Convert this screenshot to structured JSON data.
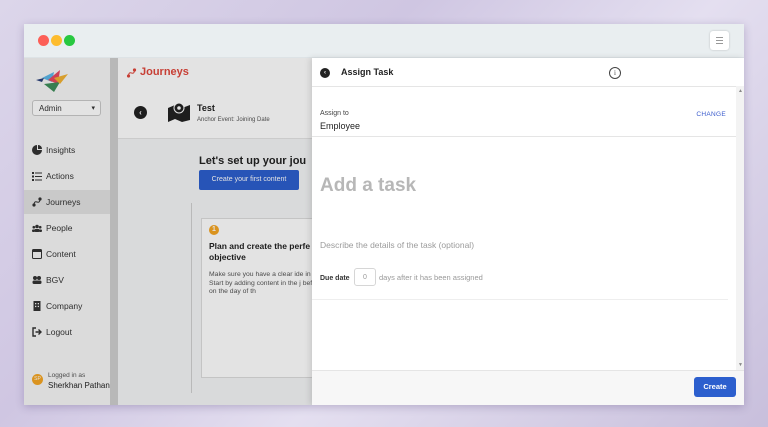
{
  "sidebar": {
    "role_select": "Admin",
    "items": [
      {
        "label": "Insights",
        "icon": "pie-chart-icon"
      },
      {
        "label": "Actions",
        "icon": "checklist-icon"
      },
      {
        "label": "Journeys",
        "icon": "journey-icon"
      },
      {
        "label": "People",
        "icon": "people-icon"
      },
      {
        "label": "Content",
        "icon": "content-icon"
      },
      {
        "label": "BGV",
        "icon": "bgv-icon"
      },
      {
        "label": "Company",
        "icon": "building-icon"
      },
      {
        "label": "Logout",
        "icon": "logout-icon"
      }
    ],
    "active_item": "Journeys",
    "logged_in_label": "Logged in as",
    "user_initials": "SP",
    "user_name": "Sherkhan Pathan"
  },
  "main": {
    "header_title": "Journeys",
    "journey_title": "Test",
    "anchor_event": "Anchor Event: Joining Date",
    "setup_heading": "Let's set up your jou",
    "create_first_button": "Create your first content",
    "card_step": "1",
    "card_title": "Plan and create the perfe objective",
    "card_text": "Make sure you have a clear ide in the journey. Start by adding content in the j before, after or on the day of th"
  },
  "panel": {
    "title": "Assign Task",
    "assign_label": "Assign to",
    "assign_value": "Employee",
    "change_label": "CHANGE",
    "task_placeholder": "Add a task",
    "description_placeholder": "Describe the details of the task (optional)",
    "due_label": "Due date",
    "due_value": "0",
    "due_suffix": "days after it has been assigned",
    "create_button": "Create"
  },
  "colors": {
    "accent": "#2c5fce",
    "journeys_title": "#e0473c",
    "badge": "#f5a623"
  }
}
